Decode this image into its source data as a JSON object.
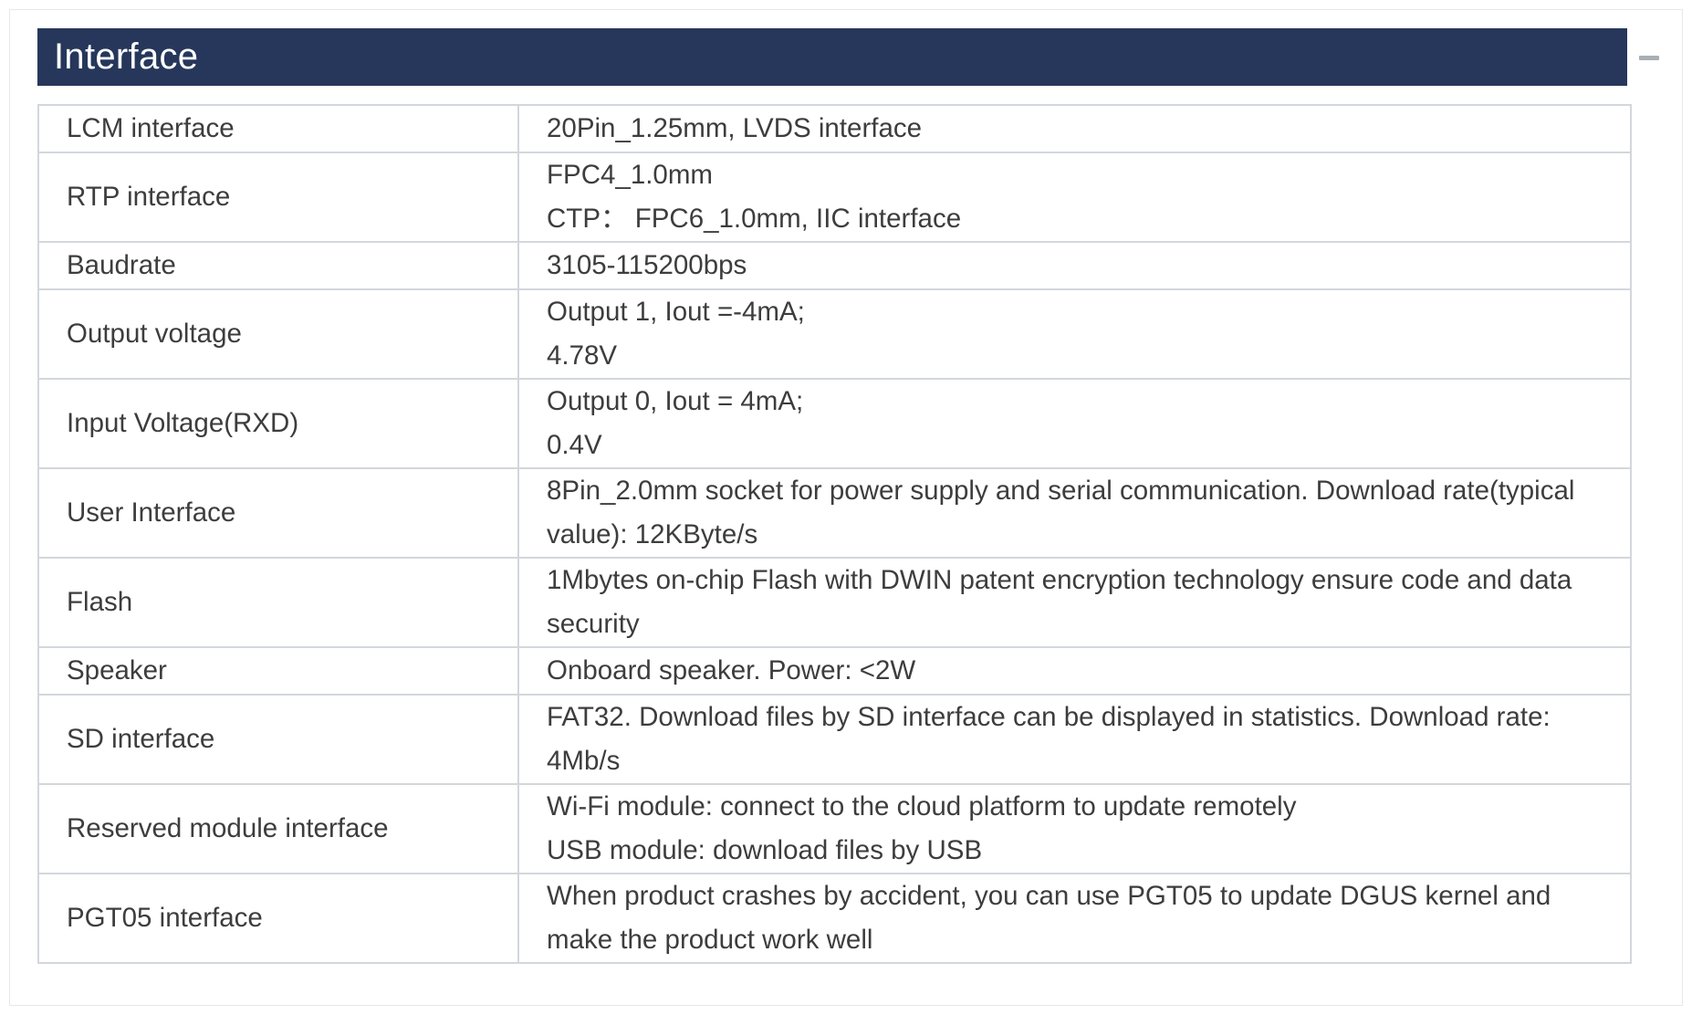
{
  "section": {
    "title": "Interface"
  },
  "rows": [
    {
      "label": "LCM interface",
      "value": [
        "20Pin_1.25mm, LVDS interface"
      ]
    },
    {
      "label": "RTP interface",
      "value": [
        "FPC4_1.0mm",
        "CTP：  FPC6_1.0mm, IIC interface"
      ]
    },
    {
      "label": "Baudrate",
      "value": [
        "3105-115200bps"
      ]
    },
    {
      "label": "Output voltage",
      "value": [
        "Output 1, Iout =-4mA;",
        "4.78V"
      ]
    },
    {
      "label": "Input Voltage(RXD)",
      "value": [
        "Output 0, Iout = 4mA;",
        "0.4V"
      ]
    },
    {
      "label": "User Interface",
      "value": [
        "8Pin_2.0mm socket for power supply and serial communication. Download rate(typical value): 12KByte/s"
      ]
    },
    {
      "label": "Flash",
      "value": [
        "1Mbytes on-chip Flash with DWIN patent encryption technology ensure code and data security"
      ]
    },
    {
      "label": "Speaker",
      "value": [
        "Onboard speaker. Power: <2W"
      ]
    },
    {
      "label": "SD interface",
      "value": [
        "FAT32. Download files by SD interface can be displayed in statistics. Download rate: 4Mb/s"
      ]
    },
    {
      "label": "Reserved module interface",
      "value": [
        "Wi-Fi module: connect to the cloud platform to update remotely",
        "USB module: download files by USB"
      ]
    },
    {
      "label": "PGT05 interface",
      "value": [
        "When product crashes by accident, you can use PGT05 to update DGUS kernel and make the product work well"
      ]
    }
  ],
  "colors": {
    "header_bg": "#26375b",
    "header_text": "#ffffff",
    "border": "#d3d7dc",
    "text": "#3d3d3d"
  },
  "icons": {
    "collapse": "minus-icon"
  }
}
